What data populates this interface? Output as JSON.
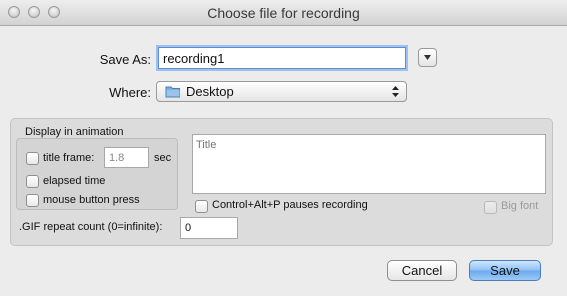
{
  "window": {
    "title": "Choose file for recording"
  },
  "save_as": {
    "label": "Save As:",
    "value": "recording1",
    "expand_icon": "triangle-down"
  },
  "where": {
    "label": "Where:",
    "value": "Desktop",
    "icon": "folder"
  },
  "display_panel": {
    "heading": "Display in animation",
    "title_frame_label": "title frame:",
    "title_frame_value": "1.8",
    "title_frame_unit": "sec",
    "elapsed_label": "elapsed time",
    "mouse_label": "mouse button press",
    "title_placeholder": "Title",
    "pause_label": "Control+Alt+P pauses recording",
    "big_font_label": "Big font",
    "gif_label": ".GIF repeat count (0=infinite):",
    "gif_value": "0"
  },
  "buttons": {
    "cancel": "Cancel",
    "save": "Save"
  }
}
